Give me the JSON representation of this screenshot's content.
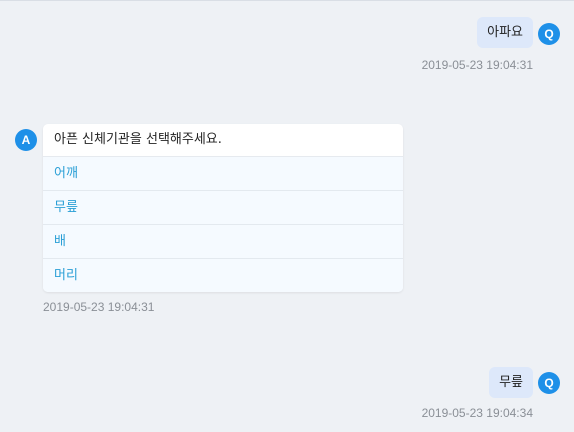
{
  "messages": [
    {
      "role_badge": "Q",
      "text": "아파요",
      "timestamp": "2019-05-23 19:04:31"
    },
    {
      "role_badge": "A",
      "text": "아픈 신체기관을 선택해주세요.",
      "options": [
        "어깨",
        "무릎",
        "배",
        "머리"
      ],
      "timestamp": "2019-05-23 19:04:31"
    },
    {
      "role_badge": "Q",
      "text": "무릎",
      "timestamp": "2019-05-23 19:04:34"
    }
  ],
  "colors": {
    "background": "#eef1f5",
    "avatar": "#1e90e8",
    "user_bubble": "#dde8fa",
    "option_text": "#2a9fd6",
    "timestamp": "#8a8f96"
  }
}
